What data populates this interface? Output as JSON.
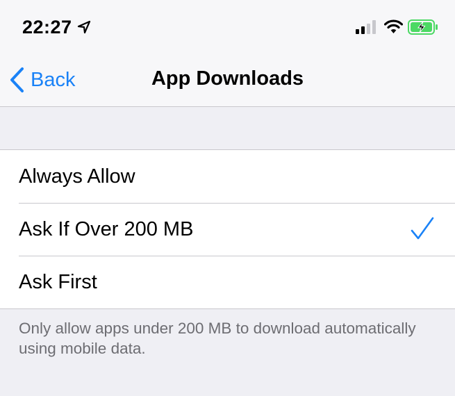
{
  "status_bar": {
    "time": "22:27",
    "icons": [
      "location-arrow-icon",
      "cellular-signal-icon",
      "wifi-icon",
      "battery-charging-icon"
    ],
    "battery_color": "#4cd964"
  },
  "nav": {
    "back_label": "Back",
    "title": "App Downloads"
  },
  "options": [
    {
      "label": "Always Allow",
      "selected": false
    },
    {
      "label": "Ask If Over 200 MB",
      "selected": true
    },
    {
      "label": "Ask First",
      "selected": false
    }
  ],
  "footer": {
    "note": "Only allow apps under 200 MB to download automatically using mobile data."
  },
  "colors": {
    "accent": "#1a82f7",
    "background": "#efeff4",
    "separator": "#c8c7cc",
    "footer_text": "#6d6d72"
  }
}
